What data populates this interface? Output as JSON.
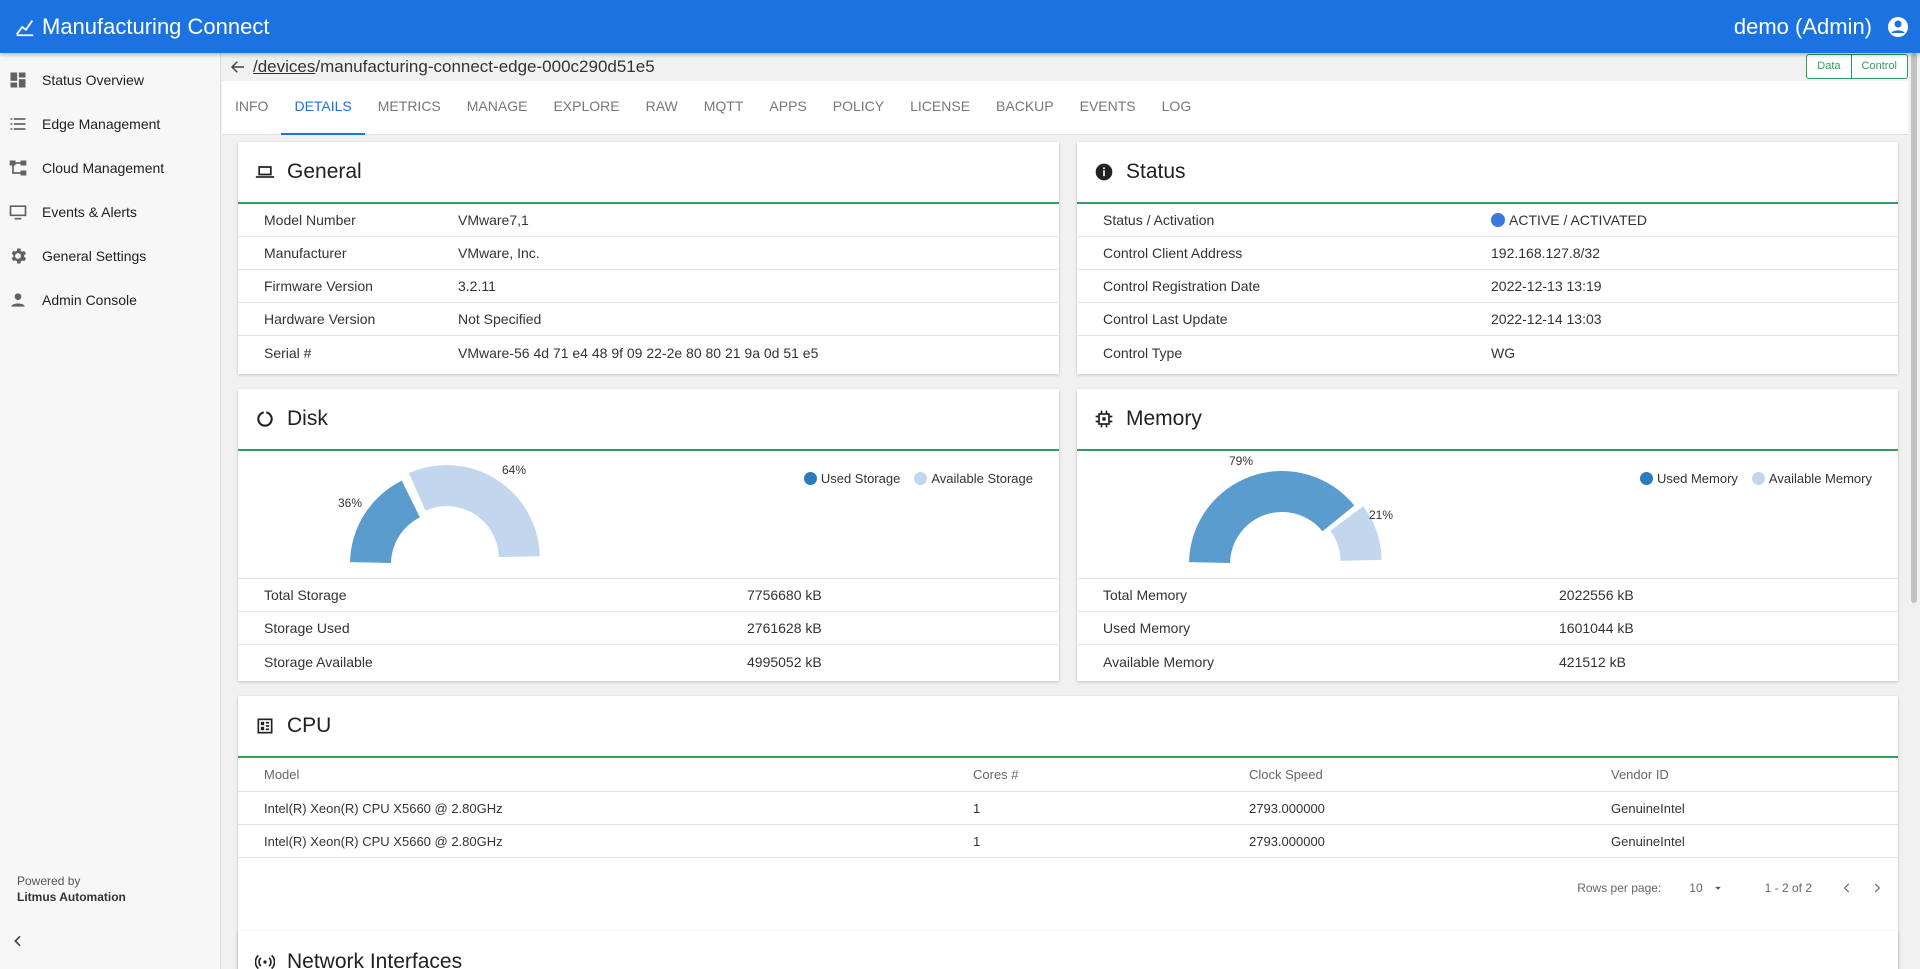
{
  "app": {
    "title": "Manufacturing Connect",
    "user": "demo (Admin)"
  },
  "sidebar": {
    "items": [
      {
        "label": "Status Overview",
        "icon": "dashboard-icon"
      },
      {
        "label": "Edge Management",
        "icon": "list-icon"
      },
      {
        "label": "Cloud Management",
        "icon": "hierarchy-icon"
      },
      {
        "label": "Events & Alerts",
        "icon": "monitor-icon"
      },
      {
        "label": "General Settings",
        "icon": "gear-icon"
      },
      {
        "label": "Admin Console",
        "icon": "person-icon"
      }
    ],
    "powered_by": "Powered by",
    "company": "Litmus Automation"
  },
  "breadcrumb": {
    "link": "/devices",
    "device": "/manufacturing-connect-edge-000c290d51e5"
  },
  "toggle": {
    "data": "Data",
    "control": "Control"
  },
  "tabs": [
    "INFO",
    "DETAILS",
    "METRICS",
    "MANAGE",
    "EXPLORE",
    "RAW",
    "MQTT",
    "APPS",
    "POLICY",
    "LICENSE",
    "BACKUP",
    "EVENTS",
    "LOG"
  ],
  "active_tab": "DETAILS",
  "general": {
    "title": "General",
    "rows": [
      {
        "k": "Model Number",
        "v": "VMware7,1"
      },
      {
        "k": "Manufacturer",
        "v": "VMware, Inc."
      },
      {
        "k": "Firmware Version",
        "v": "3.2.11"
      },
      {
        "k": "Hardware Version",
        "v": "Not Specified"
      },
      {
        "k": "Serial #",
        "v": "VMware-56 4d 71 e4 48 9f 09 22-2e 80 80 21 9a 0d 51 e5"
      }
    ]
  },
  "status": {
    "title": "Status",
    "rows": [
      {
        "k": "Status / Activation",
        "v": "ACTIVE / ACTIVATED"
      },
      {
        "k": "Control Client Address",
        "v": "192.168.127.8/32"
      },
      {
        "k": "Control Registration Date",
        "v": "2022-12-13 13:19"
      },
      {
        "k": "Control Last Update",
        "v": "2022-12-14 13:03"
      },
      {
        "k": "Control Type",
        "v": "WG"
      }
    ]
  },
  "disk": {
    "title": "Disk",
    "used_pct_label": "36%",
    "avail_pct_label": "64%",
    "legend_used": "Used Storage",
    "legend_avail": "Available Storage",
    "rows": [
      {
        "k": "Total Storage",
        "v": "7756680 kB"
      },
      {
        "k": "Storage Used",
        "v": "2761628 kB"
      },
      {
        "k": "Storage Available",
        "v": "4995052 kB"
      }
    ]
  },
  "memory": {
    "title": "Memory",
    "used_pct_label": "79%",
    "avail_pct_label": "21%",
    "legend_used": "Used Memory",
    "legend_avail": "Available Memory",
    "rows": [
      {
        "k": "Total Memory",
        "v": "2022556 kB"
      },
      {
        "k": "Used Memory",
        "v": "1601044 kB"
      },
      {
        "k": "Available Memory",
        "v": "421512 kB"
      }
    ]
  },
  "chart_data": [
    {
      "type": "pie",
      "categories": [
        "Used Storage",
        "Available Storage"
      ],
      "values": [
        36,
        64
      ]
    },
    {
      "type": "pie",
      "categories": [
        "Used Memory",
        "Available Memory"
      ],
      "values": [
        79,
        21
      ]
    }
  ],
  "colors": {
    "used": "#5b9ccf",
    "available": "#c2d6ee",
    "accent": "#1a73e0",
    "divider": "#2e9e5b"
  },
  "cpu": {
    "title": "CPU",
    "headers": [
      "Model",
      "Cores #",
      "Clock Speed",
      "Vendor ID"
    ],
    "rows": [
      [
        "Intel(R) Xeon(R) CPU X5660 @ 2.80GHz",
        "1",
        "2793.000000",
        "GenuineIntel"
      ],
      [
        "Intel(R) Xeon(R) CPU X5660 @ 2.80GHz",
        "1",
        "2793.000000",
        "GenuineIntel"
      ]
    ],
    "rows_per_page_label": "Rows per page:",
    "rows_per_page": "10",
    "range": "1 - 2 of 2"
  },
  "network": {
    "title": "Network Interfaces"
  }
}
